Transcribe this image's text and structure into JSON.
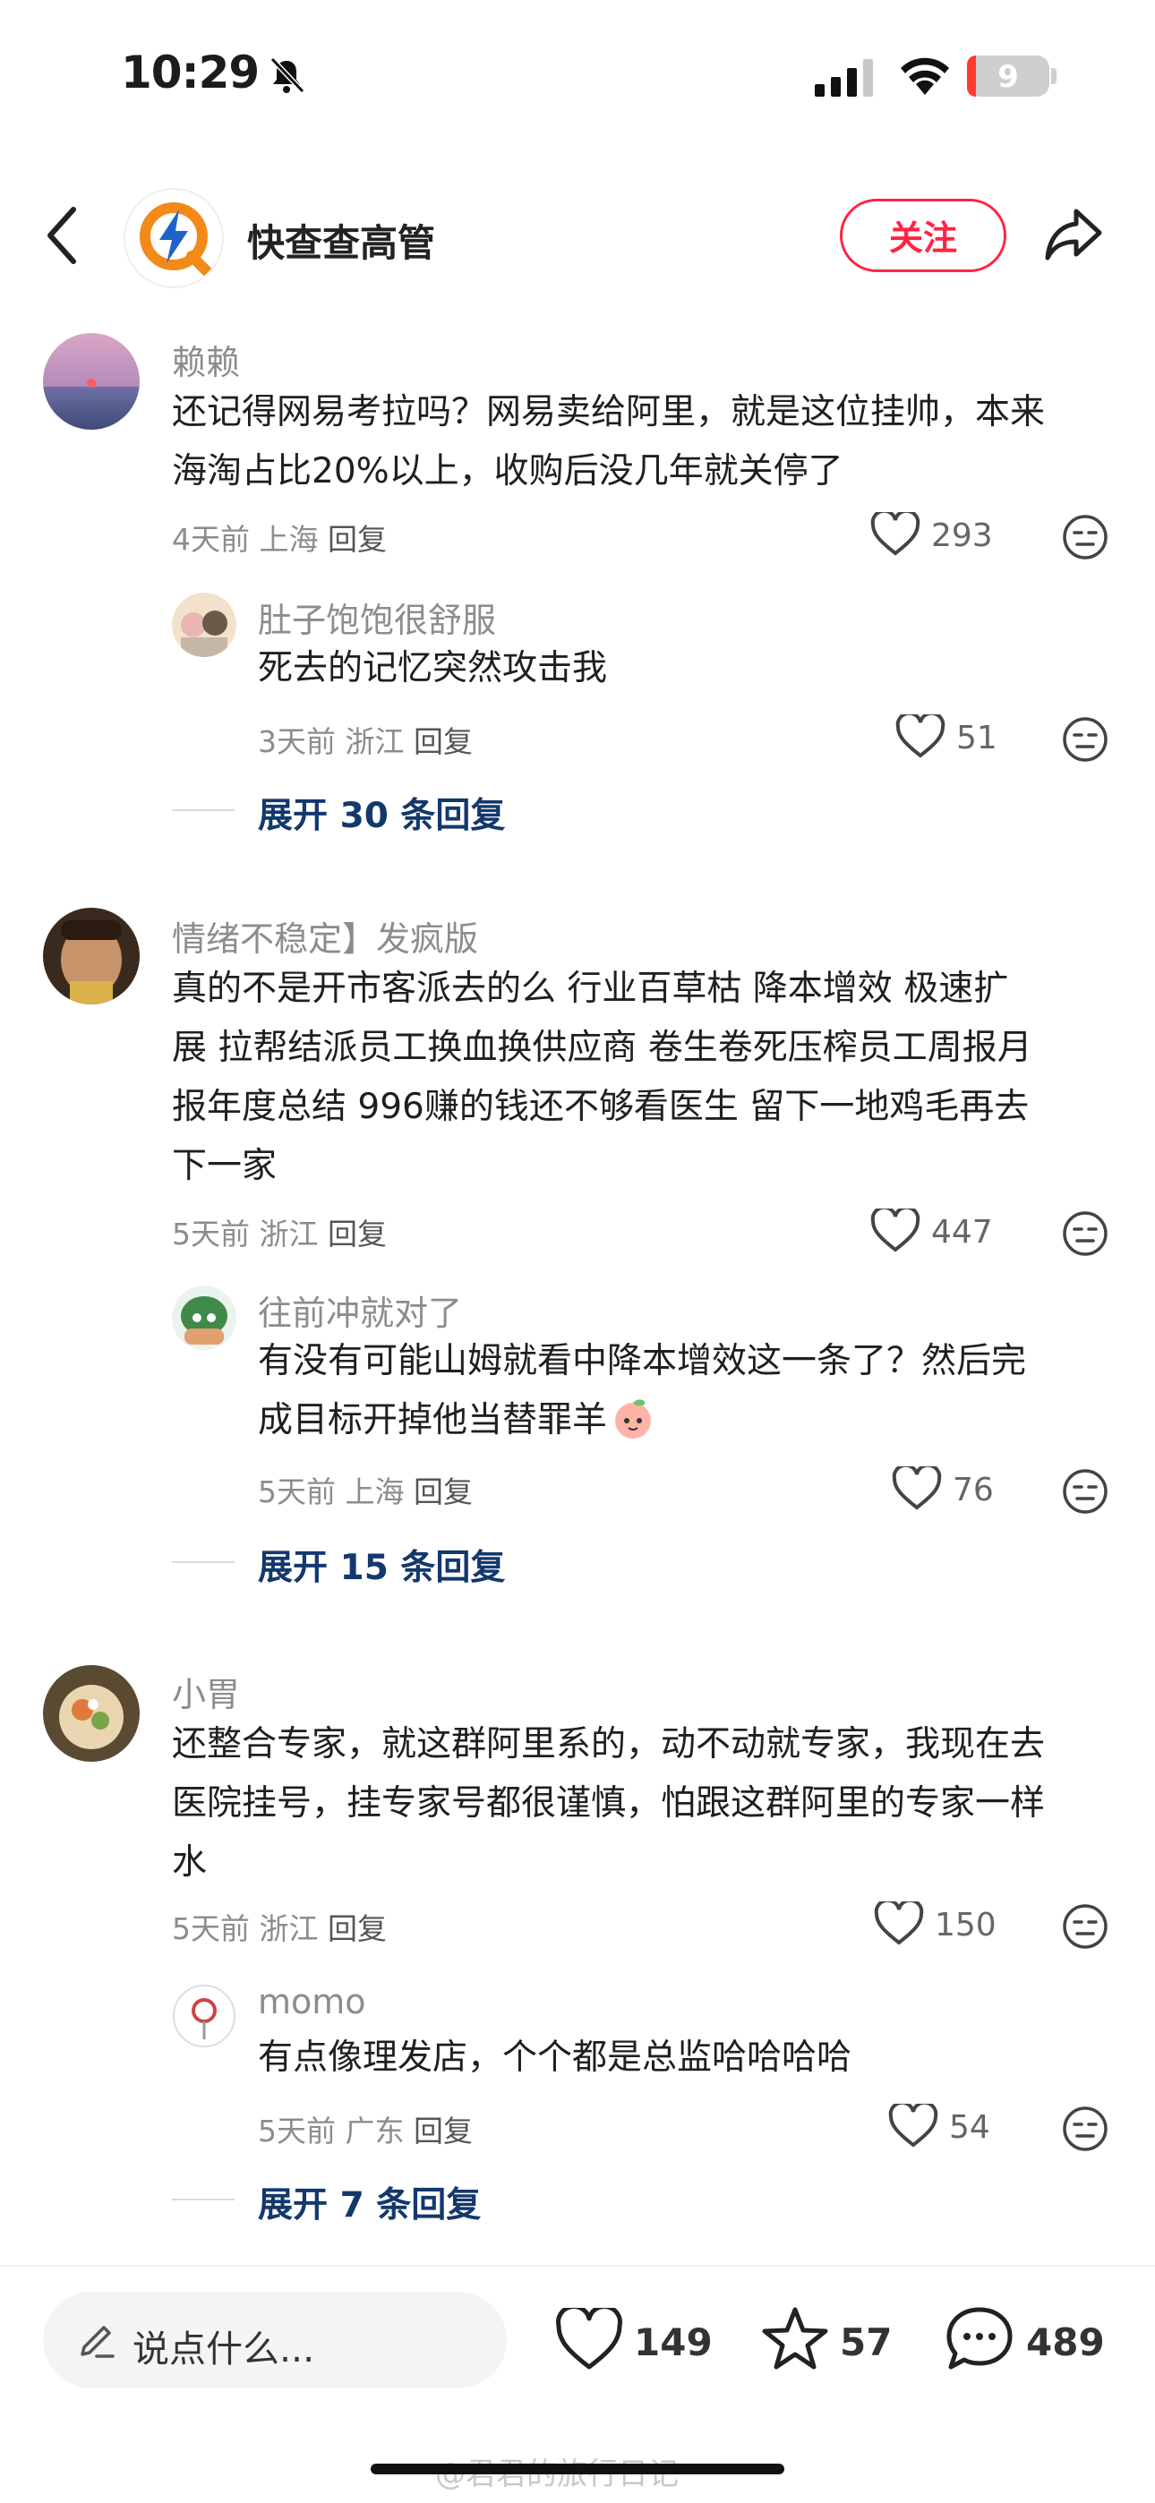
{
  "status": {
    "time": "10:29",
    "battery": "9"
  },
  "header": {
    "title": "快查查高管",
    "follow_label": "关注"
  },
  "comments": [
    {
      "name": "赖赖",
      "text_lines": [
        "还记得网易考拉吗？网易卖给阿里，就是这位挂帅，本来",
        "海淘占比20%以上，收购后没几年就关停了"
      ],
      "time": "4天前",
      "location": "上海",
      "reply_label": "回复",
      "likes": "293",
      "reply": {
        "name": "肚子饱饱很舒服",
        "text_lines": [
          "死去的记忆突然攻击我"
        ],
        "time": "3天前",
        "location": "浙江",
        "reply_label": "回复",
        "likes": "51"
      },
      "expand_label": "展开 30 条回复"
    },
    {
      "name": "情绪不稳定】发疯版",
      "text_lines": [
        "真的不是开市客派去的么  行业百草枯  降本增效  极速扩",
        "展  拉帮结派员工换血换供应商  卷生卷死压榨员工周报月",
        "报年度总结 996赚的钱还不够看医生 留下一地鸡毛再去",
        "下一家"
      ],
      "time": "5天前",
      "location": "浙江",
      "reply_label": "回复",
      "likes": "447",
      "reply": {
        "name": "往前冲就对了",
        "text_lines": [
          "有没有可能山姆就看中降本增效这一条了？然后完",
          "成目标开掉他当替罪羊"
        ],
        "time": "5天前",
        "location": "上海",
        "reply_label": "回复",
        "likes": "76"
      },
      "expand_label": "展开 15 条回复"
    },
    {
      "name": "小胃",
      "text_lines": [
        "还整合专家，就这群阿里系的，动不动就专家，我现在去",
        "医院挂号，挂专家号都很谨慎，怕跟这群阿里的专家一样",
        "水"
      ],
      "time": "5天前",
      "location": "浙江",
      "reply_label": "回复",
      "likes": "150",
      "reply": {
        "name": "momo",
        "text_lines": [
          "有点像理发店，个个都是总监哈哈哈哈"
        ],
        "time": "5天前",
        "location": "广东",
        "reply_label": "回复",
        "likes": "54"
      },
      "expand_label": "展开 7 条回复"
    }
  ],
  "bottom": {
    "input_placeholder": "说点什么...",
    "likes": "149",
    "stars": "57",
    "comments": "489"
  },
  "watermark": "@君君的旅行日记"
}
